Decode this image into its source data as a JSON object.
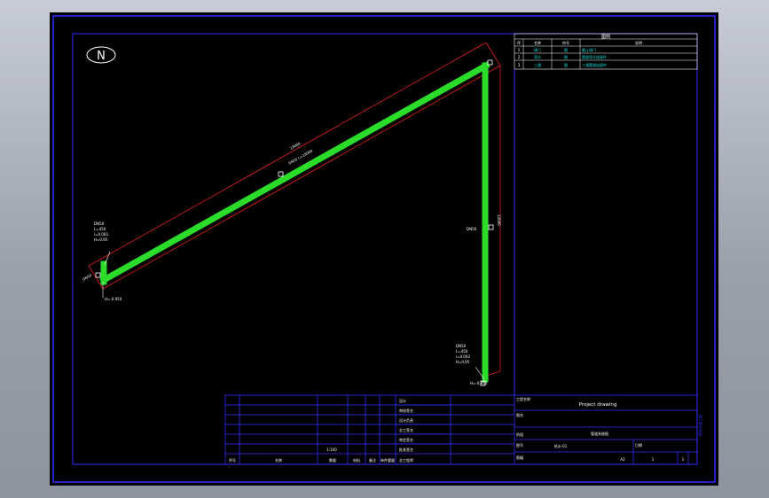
{
  "colors": {
    "page_bg": "#a3a9b4",
    "sheet_bg": "#000000",
    "frame": "#2f2fff",
    "pipe": "#2bdc2b",
    "dimension": "#e02020",
    "text_white": "#ffffff",
    "text_cyan": "#19e6e6"
  },
  "north_arrow": {
    "letter": "N",
    "icon": "north-arrow-icon"
  },
  "legend_table": {
    "title": "图例",
    "headers": [
      "序",
      "名称",
      "符号",
      "说明"
    ],
    "rows": [
      [
        "1",
        "阀门",
        "图",
        "截止阀门"
      ],
      [
        "2",
        "弯头",
        "图",
        "管道弯头连接件"
      ],
      [
        "3",
        "三通",
        "图",
        "三通管道连接件"
      ]
    ]
  },
  "pipe_labels": {
    "left_tag": [
      "DN50",
      "L=450",
      "i=0.003",
      "H=0.95"
    ],
    "left_bottom": "H=-0.950",
    "left_small": "DN50",
    "diagonal_dim": "18000",
    "diagonal_pipe": "DN50 L=18000",
    "right_dim": "12000",
    "right_pipe": "DN50",
    "bottom_tag": [
      "DN50",
      "L=450",
      "i=0.003",
      "H=0.95"
    ],
    "bottom_small": "H=-0.950"
  },
  "title_block": {
    "left_rows": [
      "",
      "",
      "",
      "",
      "",
      "",
      ""
    ],
    "mid_labels": [
      "设计",
      "审核签名",
      "设计负责",
      "总工签名",
      "审定签名",
      "批准签名",
      "总工程师"
    ],
    "scale_label": "1:100",
    "footer": [
      "序号",
      "名称",
      "数量",
      "材料",
      "备注",
      "单件重量"
    ],
    "project_label": "工程名称",
    "project_title": "Project drawing",
    "sub_label": "图名",
    "drawing_name": "管道系统图",
    "number_label": "图号",
    "drawing_number": "给水-01",
    "stage_label": "阶段",
    "date_label": "日期",
    "sheet_label": "图幅",
    "sheet_value": "A2",
    "page_value": "1",
    "total_value": "1"
  },
  "vertical_tag": "给排水施工图"
}
